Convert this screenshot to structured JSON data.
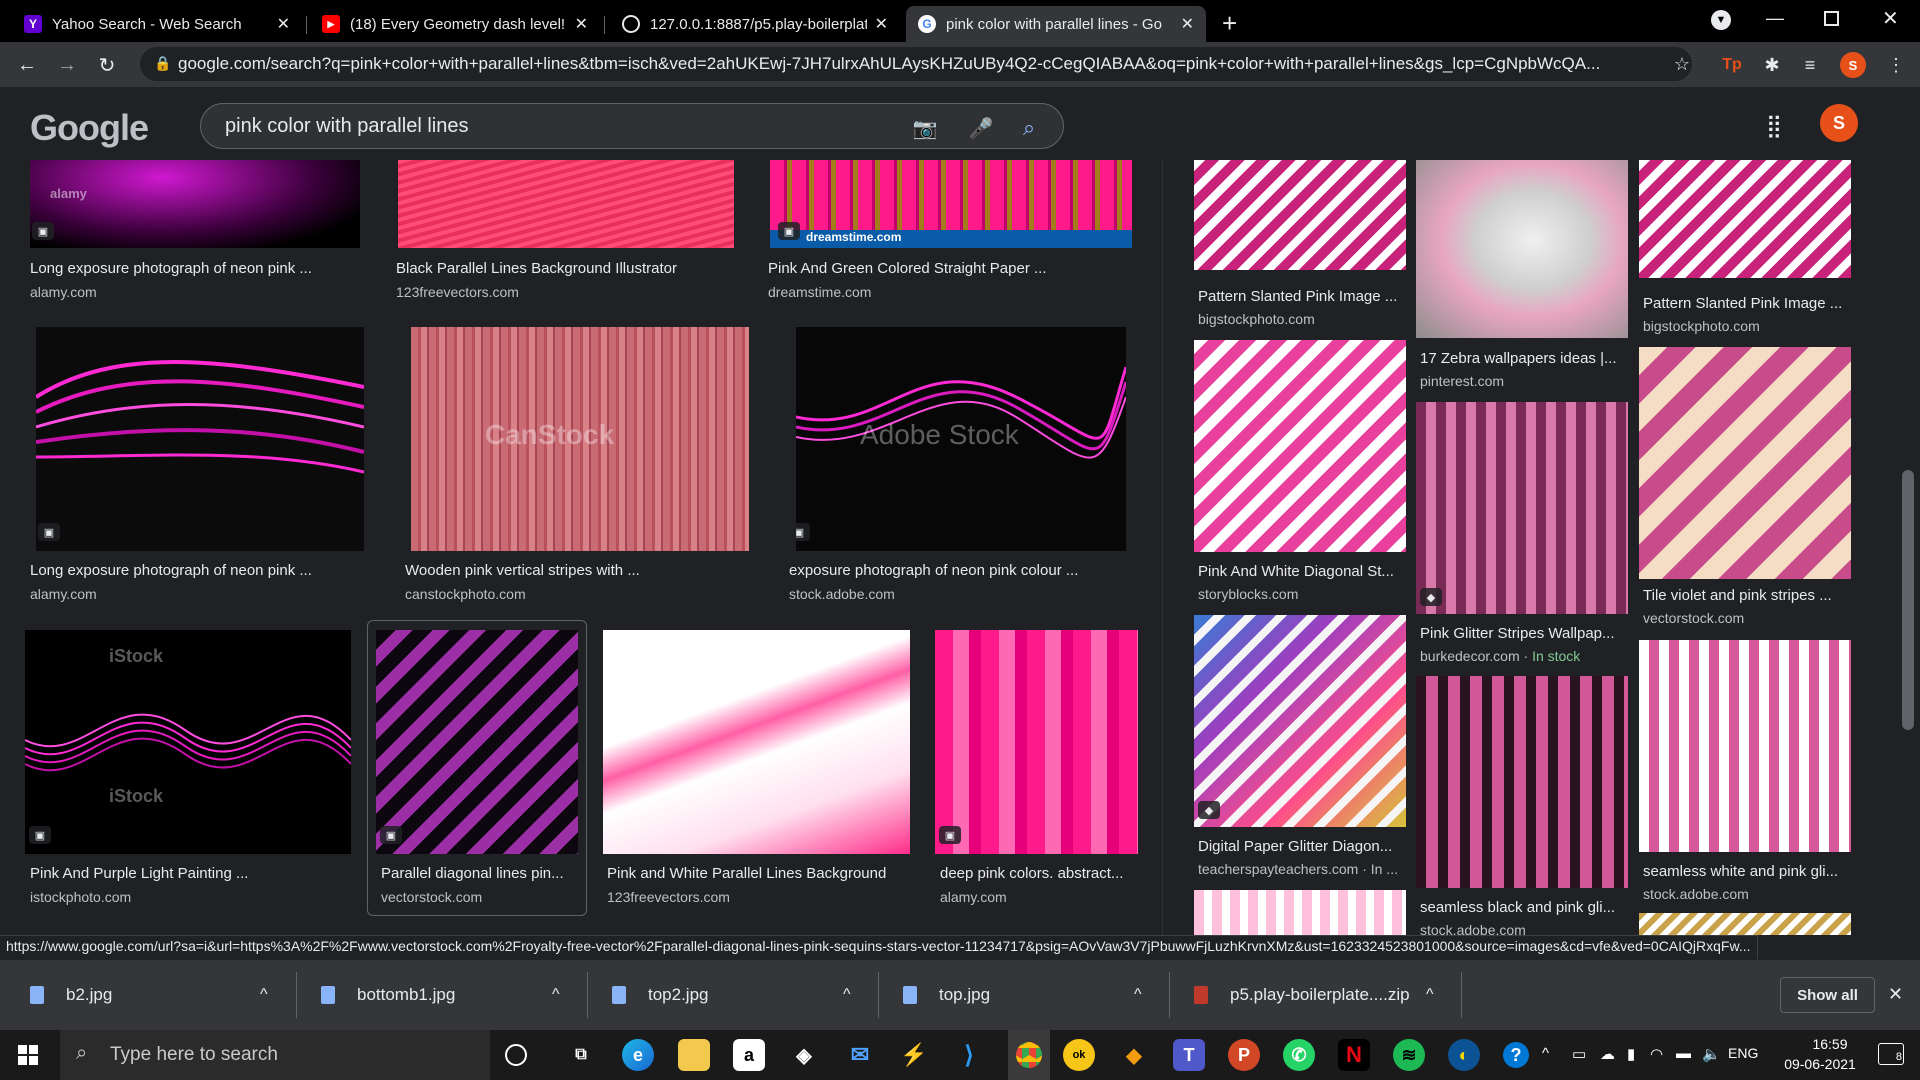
{
  "tabs": [
    {
      "title": "Yahoo Search - Web Search",
      "icon": "yahoo-icon",
      "active": false
    },
    {
      "title": "(18) Every Geometry dash level! w",
      "icon": "youtube-icon",
      "active": false
    },
    {
      "title": "127.0.0.1:8887/p5.play-boilerplat",
      "icon": "globe-icon",
      "active": false
    },
    {
      "title": "pink color with parallel lines - Go",
      "icon": "google-icon",
      "active": true
    }
  ],
  "address": {
    "url": "google.com/search?q=pink+color+with+parallel+lines&tbm=isch&ved=2ahUKEwj-7JH7ulrxAhULAysKHZuUBy4Q2-cCegQIABAA&oq=pink+color+with+parallel+lines&gs_lcp=CgNpbWcQA..."
  },
  "search": {
    "query": "pink color with parallel lines",
    "logo": "Google"
  },
  "profile": {
    "initial": "S"
  },
  "results": [
    {
      "title": "Long exposure photograph of neon pink ...",
      "source": "alamy.com"
    },
    {
      "title": "Black Parallel Lines Background Illustrator",
      "source": "123freevectors.com"
    },
    {
      "title": "Pink And Green Colored Straight Paper ...",
      "source": "dreamstime.com"
    },
    {
      "title": "Long exposure photograph of neon pink ...",
      "source": "alamy.com"
    },
    {
      "title": "Wooden pink vertical stripes with ...",
      "source": "canstockphoto.com"
    },
    {
      "title": "exposure photograph of neon pink colour ...",
      "source": "stock.adobe.com"
    },
    {
      "title": "Pink And Purple Light Painting ...",
      "source": "istockphoto.com"
    },
    {
      "title": "Parallel diagonal lines pin...",
      "source": "vectorstock.com"
    },
    {
      "title": "Pink and White Parallel Lines Background",
      "source": "123freevectors.com"
    },
    {
      "title": "deep pink colors. abstract...",
      "source": "alamy.com"
    }
  ],
  "side_results": [
    {
      "title": "Pattern Slanted Pink Image ...",
      "source": "bigstockphoto.com"
    },
    {
      "title": "17 Zebra wallpapers ideas |...",
      "source": "pinterest.com"
    },
    {
      "title": "Pattern Slanted Pink Image ...",
      "source": "bigstockphoto.com"
    },
    {
      "title": "Pink And White Diagonal St...",
      "source": "storyblocks.com"
    },
    {
      "title": "Pink Glitter Stripes Wallpap...",
      "source": "burkedecor.com",
      "extra": "In stock"
    },
    {
      "title": "Tile violet and pink stripes ...",
      "source": "vectorstock.com"
    },
    {
      "title": "Digital Paper Glitter Diagon...",
      "source": "teacherspayteachers.com · In ..."
    },
    {
      "title": "seamless black and pink gli...",
      "source": "stock.adobe.com"
    },
    {
      "title": "seamless white and pink gli...",
      "source": "stock.adobe.com"
    }
  ],
  "watermarks": {
    "canstock": "CanStock",
    "adobe": "Adobe Stock",
    "istock": "iStock",
    "alamy": "alamy",
    "dreamstime": "dreamstime.com"
  },
  "status_url": "https://www.google.com/url?sa=i&url=https%3A%2F%2Fwww.vectorstock.com%2Froyalty-free-vector%2Fparallel-diagonal-lines-pink-sequins-stars-vector-11234717&psig=AOvVaw3V7jPbuwwFjLuzhKrvnXMz&ust=1623324523801000&source=images&cd=vfe&ved=0CAIQjRxqFw...",
  "downloads": {
    "items": [
      "b2.jpg",
      "bottomb1.jpg",
      "top2.jpg",
      "top.jpg",
      "p5.play-boilerplate....zip"
    ],
    "show_all": "Show all"
  },
  "taskbar": {
    "search_placeholder": "Type here to search",
    "language": "ENG",
    "time": "16:59",
    "date": "09-06-2021",
    "notifications": "8"
  },
  "colors": {
    "accent": "#e8501a",
    "pink": "#ff1493",
    "stock": "#81c995"
  }
}
